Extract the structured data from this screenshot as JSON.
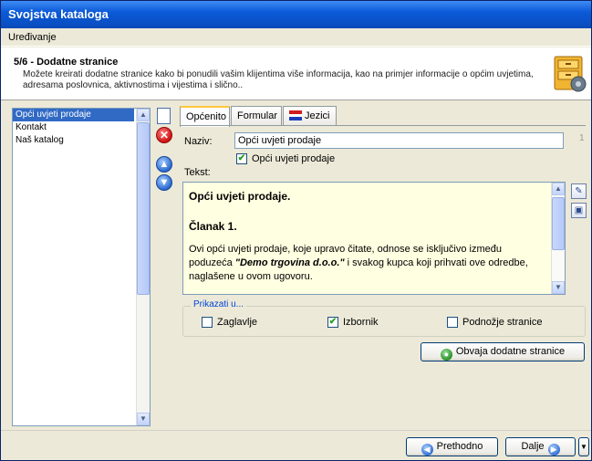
{
  "window": {
    "title": "Svojstva kataloga"
  },
  "menu": {
    "items": [
      "Uređivanje"
    ]
  },
  "header": {
    "step": "5/6 - Dodatne stranice",
    "description": "Možete kreirati dodatne stranice kako bi ponudili vašim klijentima više informacija, kao na primjer informacije o općim uvjetima, adresama poslovnica, aktivnostima i vijestima i slično.."
  },
  "pages_list": {
    "items": [
      {
        "label": "Opći uvjeti prodaje",
        "selected": true
      },
      {
        "label": "Kontakt",
        "selected": false
      },
      {
        "label": "Naš katalog",
        "selected": false
      }
    ]
  },
  "tabs": [
    {
      "label": "Općenito",
      "active": true
    },
    {
      "label": "Formular",
      "active": false
    },
    {
      "label": "Jezici",
      "active": false
    }
  ],
  "form": {
    "name_label": "Naziv:",
    "name_value": "Opći uvjeti prodaje",
    "name_counter": "1",
    "checkbox_label": "Opći uvjeti prodaje",
    "checkbox_checked": true,
    "text_label": "Tekst:"
  },
  "editor": {
    "heading": "Opći uvjeti prodaje.",
    "subheading": "Članak 1.",
    "para_before": "Ovi opći uvjeti prodaje, koje upravo čitate, odnose se isključivo između poduzeća ",
    "para_bold": "\"Demo trgovina d.o.o.\"",
    "para_after": " i svakog kupca koji prihvati ove odredbe, naglašene u ovom ugovoru."
  },
  "show_in": {
    "legend": "Prikazati u...",
    "options": [
      {
        "label": "Zaglavlje",
        "checked": false
      },
      {
        "label": "Izbornik",
        "checked": true
      },
      {
        "label": "Podnožje stranice",
        "checked": false
      }
    ]
  },
  "buttons": {
    "notify": "Obvaja dodatne stranice",
    "previous": "Prethodno",
    "next": "Dalje"
  },
  "icons": {
    "new": "new-page-icon",
    "delete": "delete-icon",
    "up": "move-up-icon",
    "down": "move-down-icon",
    "edit": "edit-icon",
    "preview": "preview-icon",
    "languages": "flag-icon",
    "catalog": "catalog-drawer-icon"
  }
}
